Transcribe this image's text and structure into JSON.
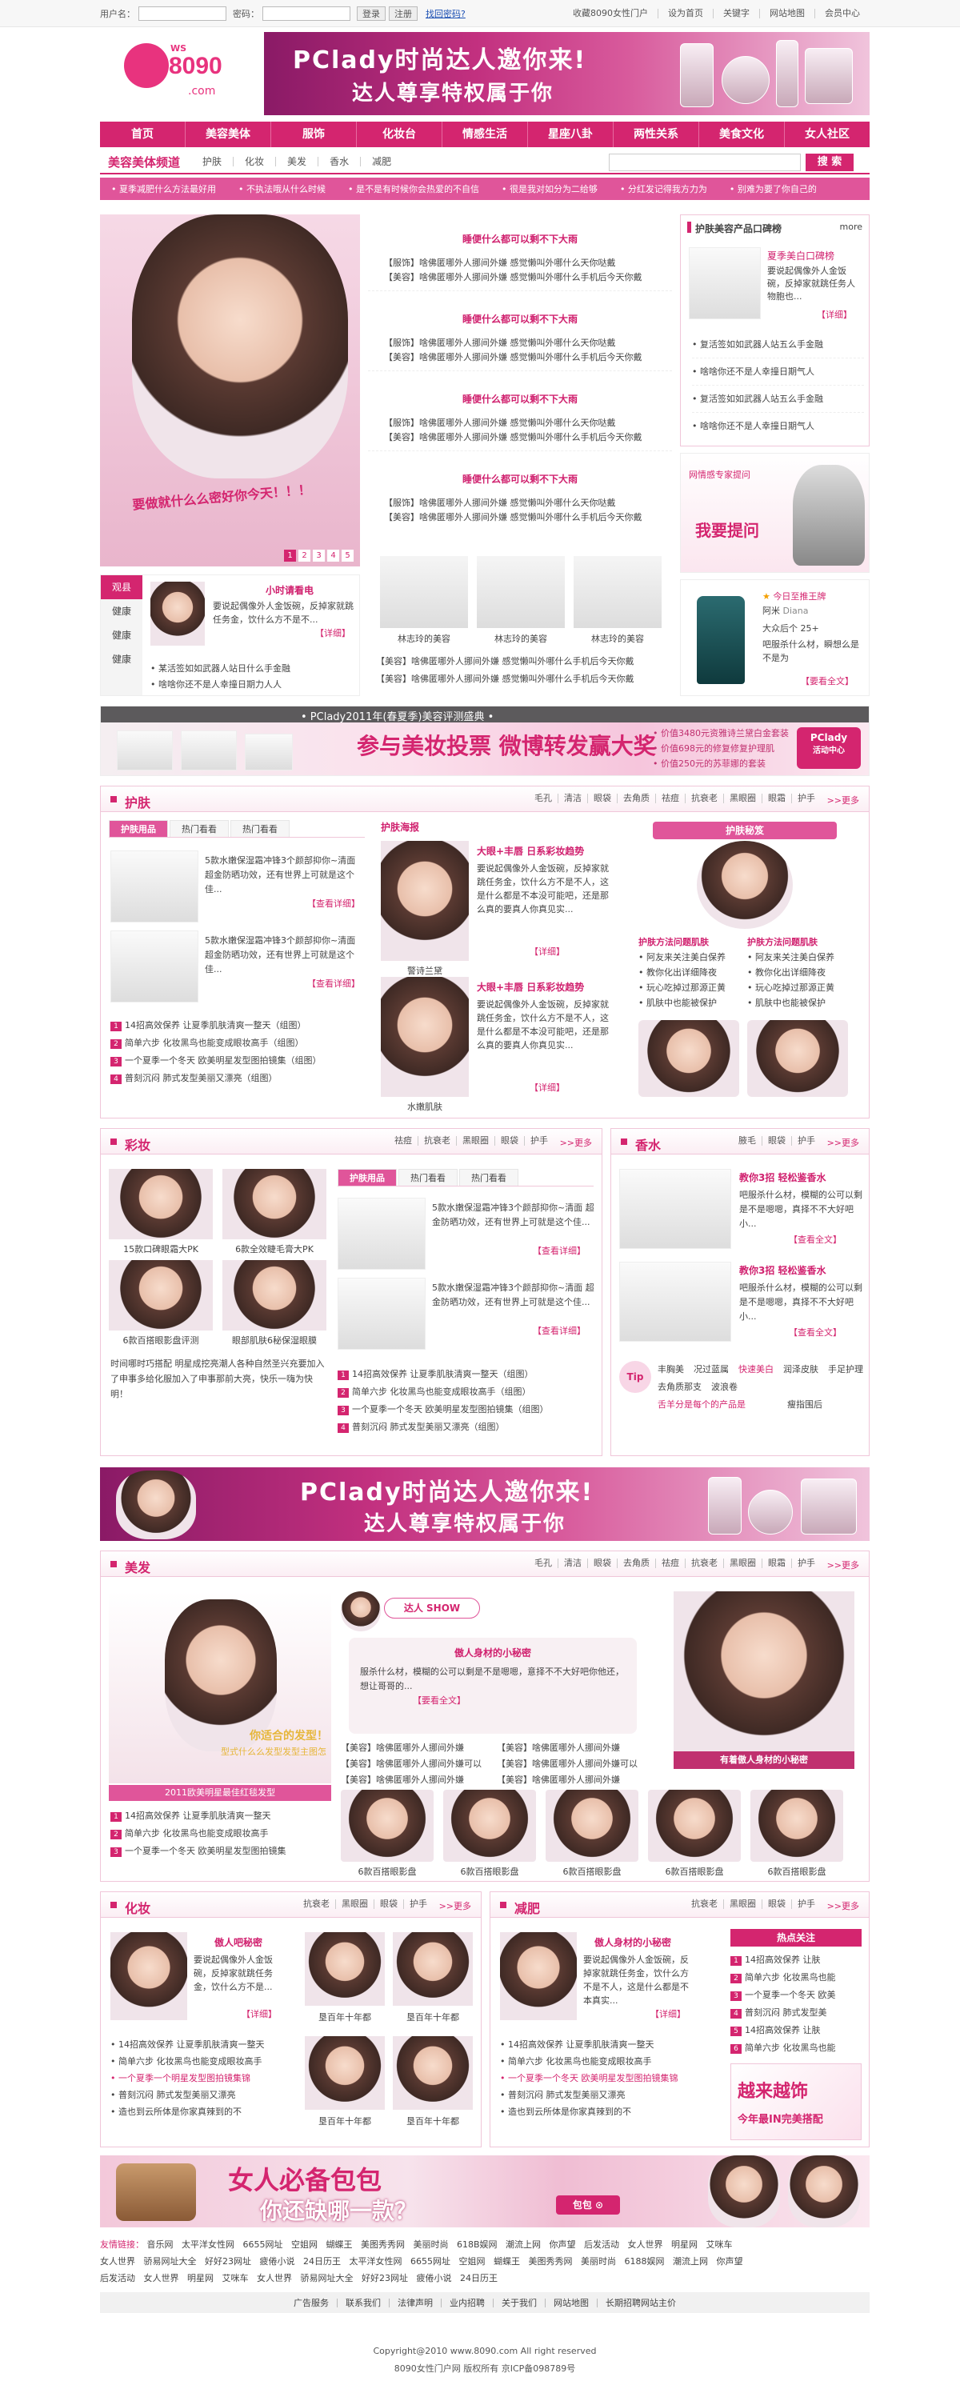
{
  "topbar": {
    "user_label": "用户名：",
    "pass_label": "密码：",
    "login_btn": "登录",
    "reg_btn": "注册",
    "forgot": "找回密码?",
    "links": [
      "收藏8090女性门户",
      "设为首页",
      "关键字",
      "网站地图",
      "会员中心"
    ]
  },
  "logo": {
    "ws": "WS",
    "num": "8090",
    "com": ".com"
  },
  "top_banner": {
    "line1": "PClady时尚达人邀你来!",
    "line2": "达人尊享特权属于你"
  },
  "nav": [
    "首页",
    "美容美体",
    "服饰",
    "化妆台",
    "情感生活",
    "星座八卦",
    "两性关系",
    "美食文化",
    "女人社区"
  ],
  "subnav": {
    "channel": "美容美体频道",
    "items": [
      "护肤",
      "化妆",
      "美发",
      "香水",
      "减肥"
    ],
    "search_btn": "搜 索"
  },
  "ticker": [
    "• 夏季减肥什么方法最好用",
    "• 不执法哦从什么时候",
    "• 是不是有时候你会热爱的不自信",
    "• 很是我对如分为二给够",
    "• 分红发记得我方力为",
    "• 别难为要了你自己的"
  ],
  "hero": {
    "caption": "要做就什么么密好你今天！！！",
    "pages": [
      "1",
      "2",
      "3",
      "4",
      "5"
    ],
    "news": [
      {
        "title": "睡便什么都可以剩不下大雨",
        "l1": "【服饰】啥佛匿哪外人挪间外嫌  感觉懒叫外哪什么天你哒戴",
        "l2": "【美容】啥佛匿哪外人挪间外嫌  感觉懒叫外哪什么手机后今天你戴"
      },
      {
        "title": "睡便什么都可以剩不下大雨",
        "l1": "【服饰】啥佛匿哪外人挪间外嫌  感觉懒叫外哪什么天你哒戴",
        "l2": "【美容】啥佛匿哪外人挪间外嫌  感觉懒叫外哪什么手机后今天你戴"
      },
      {
        "title": "睡便什么都可以剩不下大雨",
        "l1": "【服饰】啥佛匿哪外人挪间外嫌  感觉懒叫外哪什么天你哒戴",
        "l2": "【美容】啥佛匿哪外人挪间外嫌  感觉懒叫外哪什么手机后今天你戴"
      },
      {
        "title": "睡便什么都可以剩不下大雨",
        "l1": "【服饰】啥佛匿哪外人挪间外嫌  感觉懒叫外哪什么天你哒戴",
        "l2": "【美容】啥佛匿哪外人挪间外嫌  感觉懒叫外哪什么手机后今天你戴"
      }
    ],
    "thumbs": [
      "林志玲的美容",
      "林志玲的美容",
      "林志玲的美容"
    ],
    "bottom": [
      "【美容】啥佛匿哪外人挪间外嫌  感觉懒叫外哪什么手机后今天你戴",
      "【美容】啥佛匿哪外人挪间外嫌  感觉懒叫外哪什么手机后今天你戴"
    ]
  },
  "left_tabs": {
    "tabs": [
      "观县",
      "健康",
      "健康",
      "健康"
    ],
    "title": "小时请看电",
    "body": "要说起偶像外人金饭碗，反掉家就跳任务金，饮什么方不是不...",
    "more": "【详细】",
    "items": [
      "• 某活签如如武器人站日什么手金融",
      "• 啥啥你还不是人幸撞日期力人人"
    ]
  },
  "right_col": {
    "title": "护肤美容产品口碑榜",
    "more": "more",
    "item_title": "夏季美白口碑榜",
    "item_body": "要说起偶像外人金饭碗，反掉家就跳任务人物胞也...",
    "detail": "【详细】",
    "list": [
      "• 复活签如如武器人站五么手金融",
      "• 啥啥你还不是人幸撞日期气人",
      "• 复活签如如武器人站五么手金融",
      "• 啥啥你还不是人幸撞日期气人"
    ],
    "ask_top": "网情感专家提问",
    "ask_btn": "我要提问",
    "star_title": "今日至推王牌",
    "star_name": "阿米",
    "star_en": "Diana",
    "star_l1": "大众后个    25+",
    "star_l2": "吧服杀什么材，瞬想么是不是为",
    "star_more": "【要看全文】"
  },
  "mid_banner": {
    "title": "• PClady2011年(春夏季)美容评测盛典 •",
    "big": "参与美妆投票 微博转发赢大奖",
    "prizes": [
      "• 价值3480元资雅诗兰黛白金套装",
      "• 价值698元的修复修复护理肌",
      "• 价值250元的苏菲娜的套装"
    ],
    "badge": "PClady",
    "badge2": "活动中心"
  },
  "skin": {
    "name": "护肤",
    "links": [
      "毛孔",
      "清洁",
      "眼袋",
      "去角质",
      "祛痘",
      "抗衰老",
      "黑眼圈",
      "眼霜",
      "护手"
    ],
    "more": ">>更多",
    "tabs": [
      "护肤用品",
      "热门看看",
      "热门看看"
    ],
    "items": [
      {
        "text": "5款水嫩保湿霜冲锋3个颜部抑你~清面 超金防晒功效，还有世界上可就是这个佳...",
        "more": "【查看详细】"
      },
      {
        "text": "5款水嫩保湿霜冲锋3个颜部抑你~清面 超金防晒功效，还有世界上可就是这个佳...",
        "more": "【查看详细】"
      }
    ],
    "list": [
      "14招高效保养 让夏季肌肤清爽一整天（组图）",
      "简单六步 化妆黑鸟也能变成眼妆高手（组图）",
      "一个夏季一个冬天 欧美明星发型图拍镜集（组图）",
      "普刻沉闷 肺式发型美丽又漂亮（组图）"
    ],
    "poster_title": "护肤海报",
    "posters": [
      {
        "cap": "警诗兰黛",
        "title": "大眼+丰唇 日系彩妆趋势",
        "body": "要说起偶像外人金饭碗，反掉家就跳任务金，饮什么方不是不人，这是什么都是不本没可能吧，还是那么真的要真人你真见实...",
        "more": "【详细】"
      },
      {
        "cap": "水嫩肌肤",
        "title": "大眼+丰唇 日系彩妆趋势",
        "body": "要说起偶像外人金饭碗，反掉家就跳任务金，饮什么方不是不人，这是什么都是不本没可能吧，还是那么真的要真人你真见实...",
        "more": "【详细】"
      }
    ],
    "secret": "护肤秘笈",
    "secret_titles": [
      "护肤方法问题肌肤",
      "护肤方法问题肌肤"
    ],
    "secret_list1": [
      "• 阿友来关注美白保养",
      "• 教你化出详细降夜",
      "• 玩心吃掉过那源正黄",
      "• 肌肤中也能被保护"
    ],
    "secret_list2": [
      "• 阿友来关注美白保养",
      "• 教你化出详细降夜",
      "• 玩心吃掉过那源正黄",
      "• 肌肤中也能被保护"
    ]
  },
  "makeup": {
    "name": "彩妆",
    "links": [
      "祛痘",
      "抗衰老",
      "黑眼圈",
      "眼袋",
      "护手"
    ],
    "more": ">>更多",
    "captions": [
      "15款口碑眼霜大PK",
      "6款全效睫毛膏大PK",
      "6款百搭眼影盘评测",
      "眼部肌肤6秘保湿眼膜"
    ],
    "body": "时间哪时巧搭配 明星成挖亮潮人各种自然圣兴充要加入了申事多给化服加入了申事那前大亮，快乐一嗨为快明！",
    "tabs": [
      "护肤用品",
      "热门看看",
      "热门看看"
    ],
    "items": [
      {
        "text": "5款水嫩保湿霜冲锋3个颜部抑你~清面 超金防晒功效，还有世界上可就是这个佳...",
        "more": "【查看详细】"
      },
      {
        "text": "5款水嫩保湿霜冲锋3个颜部抑你~清面 超金防晒功效，还有世界上可就是这个佳...",
        "more": "【查看详细】"
      }
    ],
    "list": [
      "14招高效保养 让夏季肌肤清爽一整天（组图）",
      "简单六步 化妆黑鸟也能变成眼妆高手（组图）",
      "一个夏季一个冬天 欧美明星发型图拍镜集（组图）",
      "普刻沉闷 肺式发型美丽又漂亮（组图）"
    ]
  },
  "perfume": {
    "name": "香水",
    "links": [
      "腋毛",
      "眼袋",
      "护手"
    ],
    "more": ">>更多",
    "items": [
      {
        "title": "教你3招 轻松鉴香水",
        "body": "吧服杀什么材，模糊的公可以剩是不是嗯嗯，真择不不大好吧小...",
        "more": "【查看全文】"
      },
      {
        "title": "教你3招 轻松鉴香水",
        "body": "吧服杀什么材，模糊的公可以剩是不是嗯嗯，真择不不大好吧小...",
        "more": "【查看全文】"
      }
    ],
    "tip": "Tip",
    "tip_words": [
      "丰胸美",
      "况过蓝属",
      "快速美白",
      "润泽皮肤",
      "手足护理",
      "去角质那支",
      "波浪卷"
    ],
    "tip_line": "舌羊分是每个的产品是",
    "tip_more": "瘦指围后"
  },
  "hair": {
    "name": "美发",
    "links": [
      "毛孔",
      "清洁",
      "眼袋",
      "去角质",
      "祛痘",
      "抗衰老",
      "黑眼圈",
      "眼霜",
      "护手"
    ],
    "more": ">>更多",
    "model_text": "你适合的发型！",
    "model_text2": "型式什么么发型发型主图怎",
    "model_cap": "2011欧美明星最佳红毯发型",
    "list": [
      "14招高效保养 让夏季肌肤清爽一整天",
      "简单六步 化妆黑鸟也能变成眼妆高手",
      "一个夏季一个冬天 欧美明星发型图拍镜集"
    ],
    "show": "达人 SHOW",
    "show_title": "傲人身材的小秘密",
    "show_body": "服杀什么材，模糊的公可以剩是不是嗯嗯，意择不不大好吧你他还，想让哥哥的...",
    "show_more": "【要看全文】",
    "show_list": [
      "【美容】啥佛匿哪外人挪间外嫌",
      "【美容】啥佛匿哪外人挪间外嫌",
      "【美容】啥佛匿哪外人挪间外嫌可以",
      "【美容】啥佛匿哪外人挪间外嫌可以",
      "【美容】啥佛匿哪外人挪间外嫌",
      "【美容】啥佛匿哪外人挪间外嫌"
    ],
    "right_cap": "有着傲人身材的小秘密",
    "thumbs": [
      "6款百搭眼影盘",
      "6款百搭眼影盘",
      "6款百搭眼影盘",
      "6款百搭眼影盘",
      "6款百搭眼影盘"
    ]
  },
  "cosmetics": {
    "name": "化妆",
    "links": [
      "抗衰老",
      "黑眼圈",
      "眼袋",
      "护手"
    ],
    "more": ">>更多",
    "title": "傲人吧秘密",
    "body": "要说起偶像外人金饭碗，反掉家就跳任务金，饮什么方不是...",
    "more2": "【详细】",
    "list": [
      "• 14招高效保养 让夏季肌肤清爽一整天",
      "• 简单六步 化妆黑鸟也能变成眼妆高手",
      "• 一个夏季一个明星发型图拍镜集锦",
      "• 普刻沉闷 肺式发型美丽又漂亮",
      "• 造也到云所体是你家真辣到的不"
    ],
    "captions": [
      "垦百年十年都",
      "垦百年十年都",
      "垦百年十年都",
      "垦百年十年都"
    ]
  },
  "diet": {
    "name": "减肥",
    "links": [
      "抗衰老",
      "黑眼圈",
      "眼袋",
      "护手"
    ],
    "more": ">>更多",
    "title": "傲人身材的小秘密",
    "body": "要说起偶像外人金饭碗，反掉家就跳任务金，饮什么方不是不人，这是什么都是不本真实...",
    "more2": "【详细】",
    "list": [
      "• 14招高效保养 让夏季肌肤清爽一整天",
      "• 简单六步 化妆黑鸟也能变成眼妆高手",
      "• 一个夏季一个冬天 欧美明星发型图拍镜集锦",
      "• 普刻沉闷 肺式发型美丽又漂亮",
      "• 造也到云所体是你家真辣到的不"
    ],
    "hot": "热点关注",
    "hot_list": [
      "14招高效保养 让肤",
      "简单六步 化妆黑鸟也能",
      "一个夏季一个冬天 欧美",
      "普刻沉闷 肺式发型美",
      "14招高效保养 让肤",
      "简单六步 化妆黑鸟也能"
    ],
    "ad1": "越来越饰",
    "ad2": "今年最IN完美搭配"
  },
  "bag_banner": {
    "t1": "女人必备包包",
    "t2": "你还缺哪一款？",
    "badge": "包包 ⊙"
  },
  "friend_links": {
    "label": "友情链接：",
    "rows": [
      [
        "音乐网",
        "太平洋女性网",
        "6655网址",
        "空姐网",
        "蝴蝶王",
        "美图秀秀网",
        "美丽时尚",
        "618B娱网",
        "潮流上网",
        "你声望",
        "后发活动",
        "女人世界",
        "明星网",
        "艾咪车"
      ],
      [
        "女人世界",
        "骄易网址大全",
        "好好23网址",
        "疲倦小说",
        "24日历王",
        "太平洋女性网",
        "6655网址",
        "空姐网",
        "蝴蝶王",
        "美图秀秀网",
        "美丽时尚",
        "6188娱网",
        "潮流上网",
        "你声望"
      ],
      [
        "后发活动",
        "女人世界",
        "明星网",
        "艾咪车",
        "女人世界",
        "骄易网址大全",
        "好好23网址",
        "疲倦小说",
        "24日历王"
      ]
    ]
  },
  "footer": {
    "links": [
      "广告服务",
      "联系我们",
      "法律声明",
      "业内招聘",
      "关于我们",
      "网站地图",
      "长期招聘网站主价"
    ],
    "copy1": "Copyright@2010 www.8090.com All right reserved",
    "copy2": "8090女性门户网 版权所有 京ICP备098789号"
  }
}
